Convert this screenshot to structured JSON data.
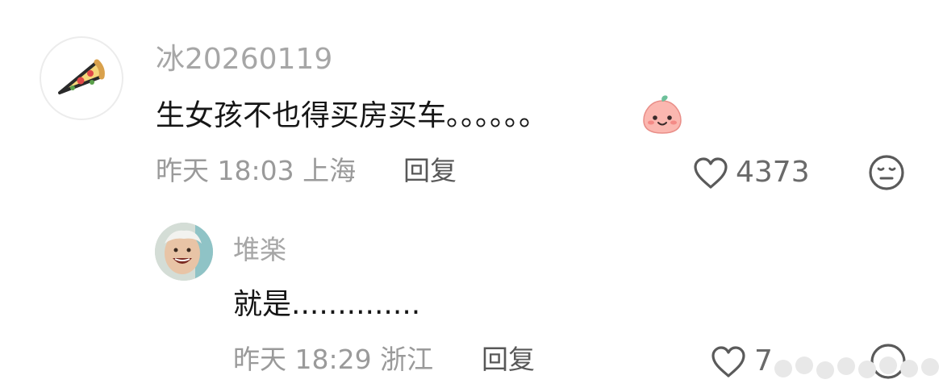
{
  "comment": {
    "avatar_icon": "pizza-icon",
    "username": "冰20260119",
    "text": "生女孩不也得买房买车。。。。。。",
    "emoji": "peach-smile-emoji",
    "time": "昨天 18:03",
    "location": "上海",
    "reply_label": "回复",
    "like_count": "4373",
    "like_icon": "heart-outline-icon",
    "dislike_icon": "meh-face-icon"
  },
  "reply": {
    "username": "堆楽",
    "text": "就是..............",
    "time": "昨天 18:29",
    "location": "浙江",
    "reply_label": "回复",
    "like_count": "7",
    "like_icon": "heart-outline-icon",
    "dislike_icon": "meh-face-icon"
  },
  "colors": {
    "username": "#a6a6a6",
    "text": "#161616",
    "meta": "#9a9a9a",
    "action": "#585858"
  }
}
